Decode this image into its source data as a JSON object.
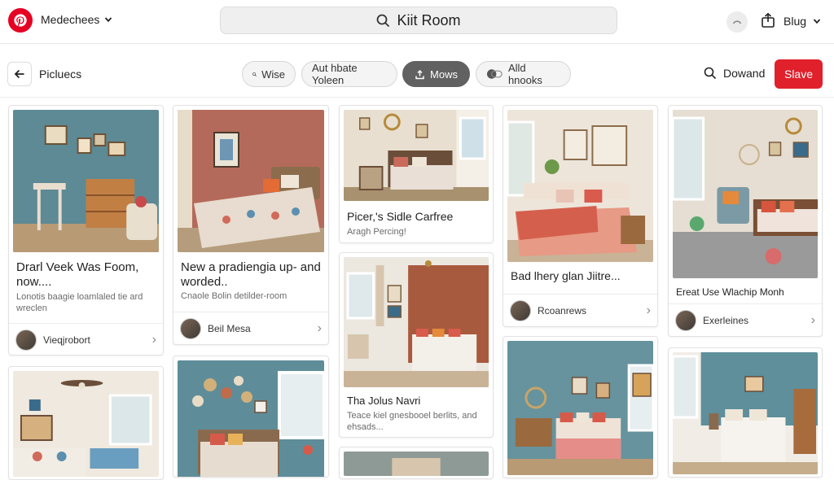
{
  "topbar": {
    "workspace": "Medechees",
    "search_query": "Kiit Room",
    "blog_label": "Blug",
    "icons": [
      "pinterest-logo",
      "search-icon",
      "chevron-down-icon",
      "loading-icon",
      "share-icon"
    ]
  },
  "subbar": {
    "title": "Picluecs",
    "chips": [
      {
        "label": "Wise",
        "icon": "search-icon"
      },
      {
        "label": "Aut hbate Yoleen",
        "icon": ""
      },
      {
        "label": "Mows",
        "icon": "upload-icon"
      },
      {
        "label": "Alld hnooks",
        "icon": "toggle-icon"
      }
    ],
    "download_label": "Dowand",
    "save_label": "Slave"
  },
  "cards": [
    {
      "title": "Drarl Veek Was Foom, now....",
      "subtitle": "Lonotis baagie loamlaled tie ard wreclen",
      "author": "Vieqjrobort"
    },
    {
      "title": "New a pradiengia up- and worded..",
      "subtitle": "Cnaole Bolin detilder-room",
      "author": "Beil Mesa"
    },
    {
      "title": "Picer,'s Sidle Carfree",
      "subtitle": "Aragh Percing!",
      "author": ""
    },
    {
      "title": "Bad lhery glan Jiitre...",
      "subtitle": "",
      "author": "Rcoanrews"
    },
    {
      "title": "Ereat Use Wlachip Monh",
      "subtitle": "",
      "author": "Exerleines"
    },
    {
      "title": "Tha Jolus Navri",
      "subtitle": "Teace kiel gnesbooel berlits, and ehsads...",
      "author": ""
    }
  ],
  "colors": {
    "brand": "#e60023",
    "save_button": "#e0202b",
    "active_chip": "#616161"
  }
}
